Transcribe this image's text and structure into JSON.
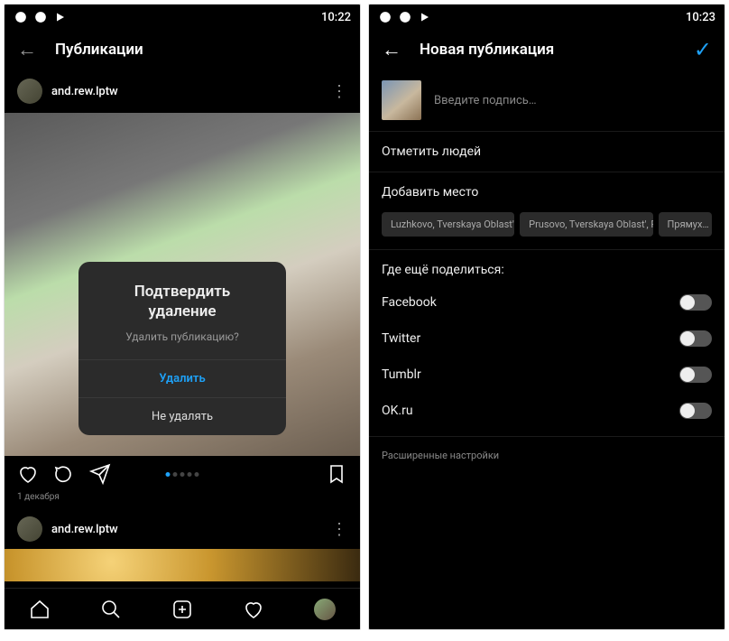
{
  "left": {
    "status_time": "10:22",
    "header_title": "Публикации",
    "username": "and.rew.lptw",
    "post_date": "1 декабря",
    "dialog": {
      "title_line1": "Подтвердить",
      "title_line2": "удаление",
      "message": "Удалить публикацию?",
      "delete": "Удалить",
      "cancel": "Не удалять"
    }
  },
  "right": {
    "status_time": "10:23",
    "header_title": "Новая публикация",
    "caption_placeholder": "Введите подпись…",
    "tag_people": "Отметить людей",
    "add_location": "Добавить место",
    "location_chips": [
      "Luzhkovo, Tverskaya Oblast', …",
      "Prusovo, Tverskaya Oblast', R…",
      "Прямух…"
    ],
    "share_also": "Где ещё поделиться:",
    "share_targets": [
      "Facebook",
      "Twitter",
      "Tumblr",
      "OK.ru"
    ],
    "advanced": "Расширенные настройки"
  }
}
